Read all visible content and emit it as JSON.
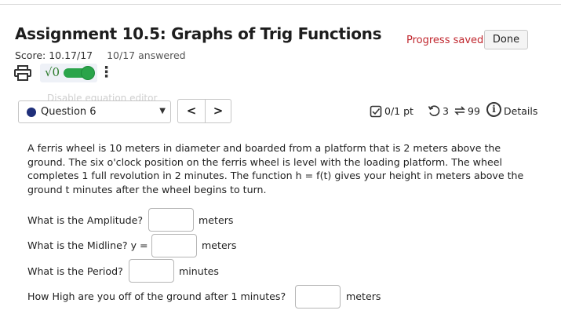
{
  "header": {
    "title": "Assignment 10.5: Graphs of Trig Functions",
    "score_label": "Score: 10.17/17",
    "answered_label": "10/17 answered",
    "progress_text": "Progress saved",
    "done_label": "Done"
  },
  "tools": {
    "printer_icon": "printer-icon",
    "equation_editor_symbol": "√0",
    "equation_editor_enabled": true,
    "more_icon": "⋮",
    "ghost_text": "Disable equation editor"
  },
  "question_nav": {
    "selected_question": "Question 6",
    "prev_label": "<",
    "next_label": ">"
  },
  "status": {
    "points": "0/1 pt",
    "retries": "3",
    "submissions": "99",
    "details_label": "Details"
  },
  "problem": {
    "text": "A ferris wheel is 10 meters in diameter and boarded from a platform that is 2 meters above the ground. The six o'clock position on the ferris wheel is level with the loading platform. The wheel completes 1 full revolution in 2 minutes. The function h = f(t) gives your height in meters above the ground t minutes after the wheel begins to turn.",
    "questions": [
      {
        "prompt": "What is the Amplitude?",
        "unit": "meters",
        "value": ""
      },
      {
        "prompt": "What is the Midline? y =",
        "unit": "meters",
        "value": ""
      },
      {
        "prompt": "What is the Period?",
        "unit": "minutes",
        "value": ""
      },
      {
        "prompt": "How High are you off of the ground after 1 minutes?",
        "unit": "meters",
        "value": ""
      }
    ]
  },
  "colors": {
    "accent_red": "#c0262d",
    "toggle_green": "#2aa44a",
    "question_dot": "#1f2f7a"
  }
}
